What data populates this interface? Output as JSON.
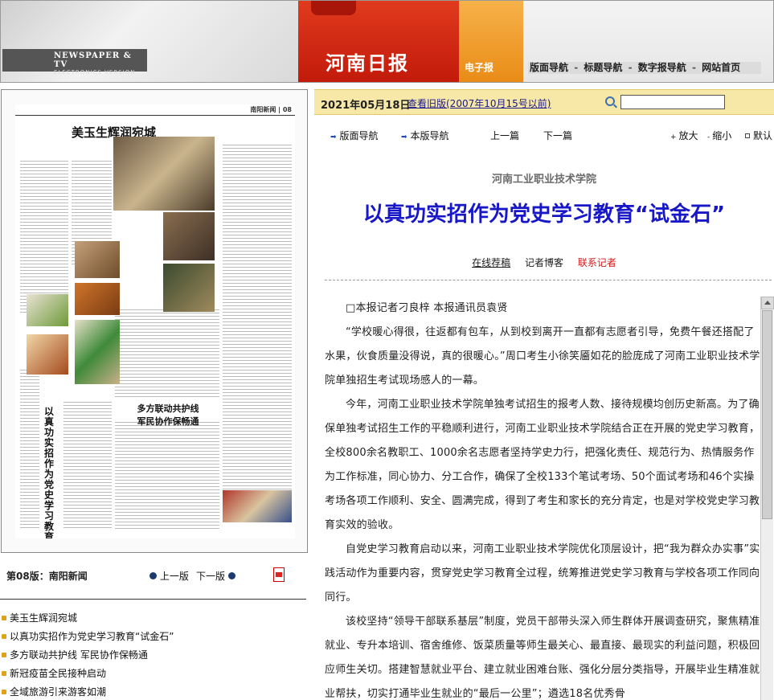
{
  "banner": {
    "brand_line1": "NEWSPAPER & TV",
    "brand_line2": "ELECTRONICS VERSION",
    "paper_name": "河南日报",
    "edition_type": "电子报",
    "nav": [
      "版面导航",
      "标题导航",
      "数字报导航",
      "网站首页"
    ],
    "nav_sep": "-"
  },
  "date_bar": {
    "date": "2021年05月18日",
    "old_version_link": "查看旧版(2007年10月15号以前)",
    "search_placeholder": ""
  },
  "tools": {
    "page_nav": "版面导航",
    "this_page_nav": "本版导航",
    "prev_article": "上一篇",
    "next_article": "下一篇",
    "zoom_in": "放大",
    "zoom_out": "缩小",
    "default": "默认"
  },
  "thumbnail": {
    "header_pagenum": "南阳新闻 | 08",
    "headline": "美玉生辉润宛城"
  },
  "page_bar": {
    "page_label": "第08版：南阳新闻",
    "prev_page": "上一版",
    "next_page": "下一版"
  },
  "article_list": [
    "美玉生辉润宛城",
    "以真功实招作为党史学习教育“试金石”",
    "多方联动共护线 军民协作保畅通",
    "新冠疫苗全民接种启动",
    "全域旅游引来游客如潮"
  ],
  "article": {
    "subtitle": "河南工业职业技术学院",
    "title": "以真功实招作为党史学习教育“试金石”",
    "meta": {
      "online": "在线荐稿",
      "blog": "记者博客",
      "contact": "联系记者"
    },
    "paragraphs": [
      "□本报记者刁良梓 本报通讯员袁贤",
      "“学校暖心得很，往返都有包车，从到校到离开一直都有志愿者引导，免费午餐还搭配了水果，伙食质量没得说，真的很暖心。”周口考生小徐笑靥如花的脸庞成了河南工业职业技术学院单独招生考试现场感人的一幕。",
      "今年，河南工业职业技术学院单独考试招生的报考人数、接待规模均创历史新高。为了确保单独考试招生工作的平稳顺利进行，河南工业职业技术学院结合正在开展的党史学习教育，全校800余名教职工、1000余名志愿者坚持学史力行，把强化责任、规范行为、热情服务作为工作标准，同心协力、分工合作，确保了全校133个笔试考场、50个面试考场和46个实操考场各项工作顺利、安全、圆满完成，得到了考生和家长的充分肯定，也是对学校党史学习教育实效的验收。",
      "自党史学习教育启动以来，河南工业职业技术学院优化顶层设计，把“我为群众办实事”实践活动作为重要内容，贯穿党史学习教育全过程，统筹推进党史学习教育与学校各项工作同向同行。",
      "该校坚持“领导干部联系基层”制度，党员干部带头深入师生群体开展调查研究，聚焦精准就业、专升本培训、宿舍维修、饭菜质量等师生最关心、最直接、最现实的利益问题，积极回应师生关切。搭建智慧就业平台、建立就业困难台账、强化分层分类指导，开展毕业生精准就业帮扶，切实打通毕业生就业的“最后一公里”；遴选18名优秀骨"
    ]
  },
  "colors": {
    "title_blue": "#1717c8",
    "date_bar_bg": "#f7e8a8",
    "contact_red": "#d11a1a",
    "banner_red": "#c21a0a",
    "banner_orange": "#e98b16"
  }
}
